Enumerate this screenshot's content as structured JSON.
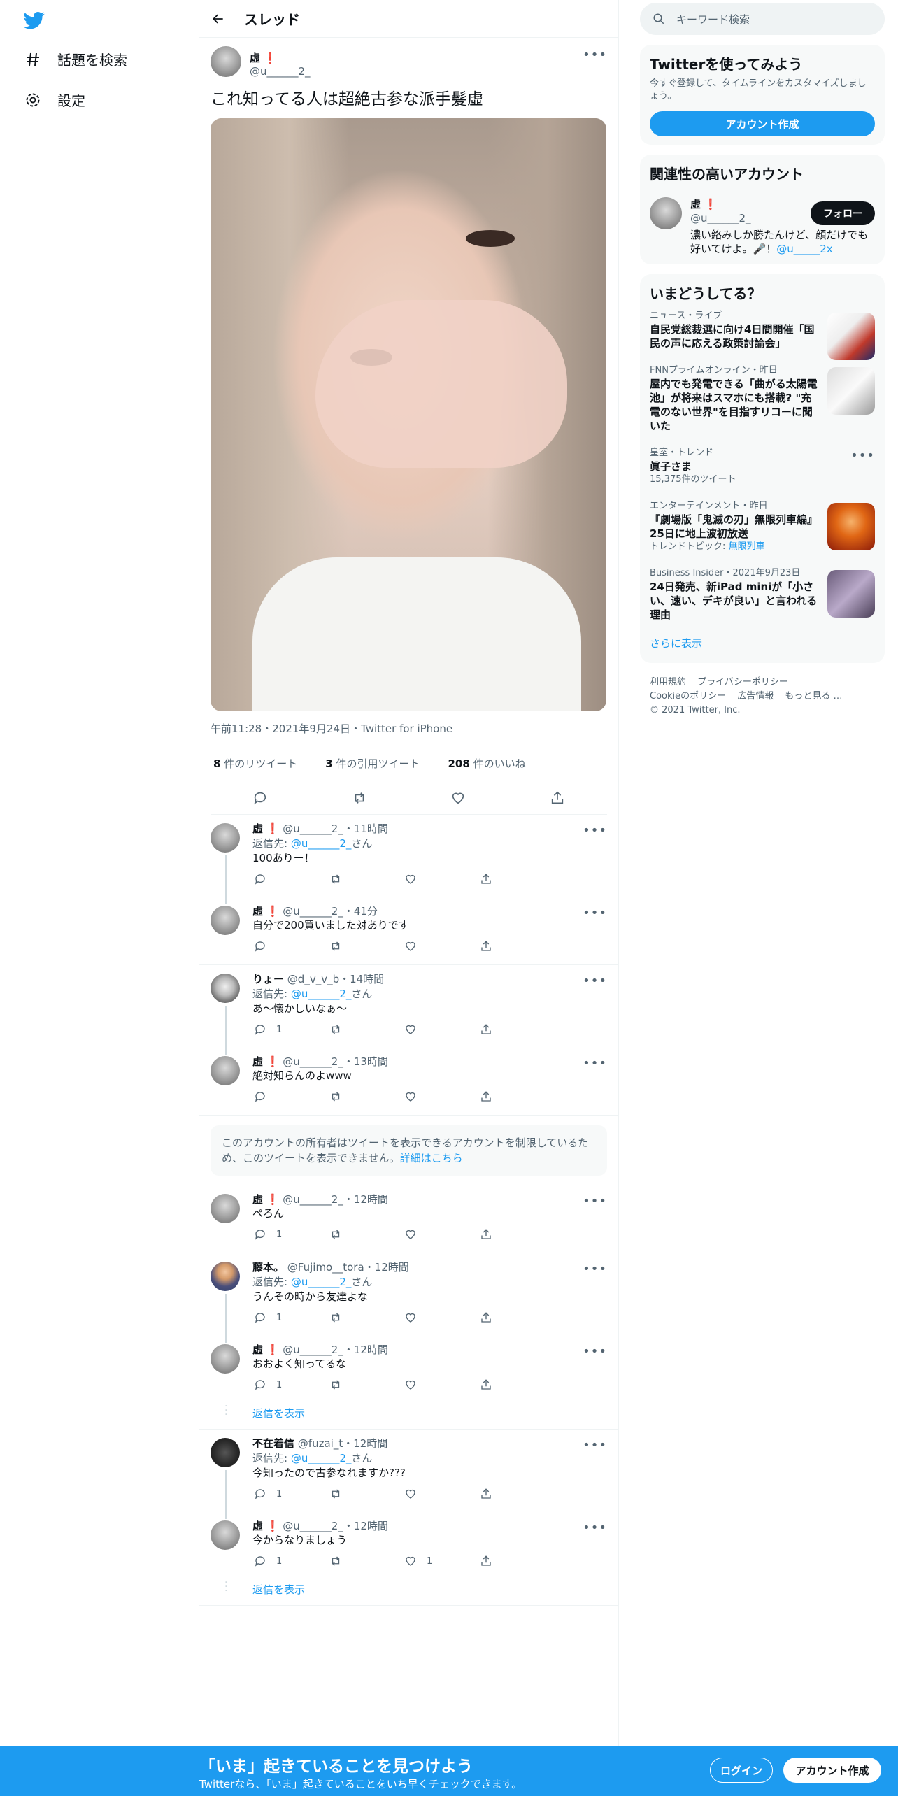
{
  "colors": {
    "accent": "#1d9bf0",
    "text": "#0f1419",
    "muted": "#536471",
    "warn": "#e0245e"
  },
  "nav": {
    "items": [
      {
        "icon": "hashtag-icon",
        "label": "話題を検索"
      },
      {
        "icon": "gear-icon",
        "label": "設定"
      }
    ]
  },
  "header": {
    "title": "スレッド"
  },
  "main_tweet": {
    "name": "虛",
    "handle": "@u______2_",
    "text": "これ知ってる人は超絶古参な派手髪虛",
    "meta": "午前11:28・2021年9月24日・Twitter for iPhone",
    "retweets": "8",
    "retweets_label": "件のリツイート",
    "quotes": "3",
    "quotes_label": "件の引用ツイート",
    "likes": "208",
    "likes_label": "件のいいね"
  },
  "replies": [
    {
      "name": "虛",
      "sub": "@u______2_・11時間",
      "reply_to_prefix": "返信先: ",
      "reply_to": "@u______2_",
      "reply_to_suffix": "さん",
      "text": "100ありー！",
      "reply_count": "",
      "like_count": ""
    },
    {
      "name": "虛",
      "sub": "@u______2_・41分",
      "text": "自分で200買いました対ありです",
      "reply_count": "",
      "like_count": ""
    },
    {
      "name": "りょー",
      "sub": "@d_v_v_b・14時間",
      "reply_to_prefix": "返信先: ",
      "reply_to": "@u______2_",
      "reply_to_suffix": "さん",
      "text": "あ～懐かしいなぁ〜",
      "reply_count": "1",
      "like_count": ""
    },
    {
      "name": "虛",
      "sub": "@u______2_・13時間",
      "text": "絶対知らんのよwww",
      "reply_count": "",
      "like_count": ""
    },
    {
      "name": "虛",
      "sub": "@u______2_・12時間",
      "text": "ぺろん",
      "reply_count": "1",
      "like_count": ""
    },
    {
      "name": "藤本。",
      "sub": "@Fujimo__tora・12時間",
      "reply_to_prefix": "返信先: ",
      "reply_to": "@u______2_",
      "reply_to_suffix": "さん",
      "text": "うんその時から友達よな",
      "reply_count": "1",
      "like_count": ""
    },
    {
      "name": "虛",
      "sub": "@u______2_・12時間",
      "text": "おおよく知ってるな",
      "reply_count": "1",
      "like_count": ""
    },
    {
      "name": "不在着信",
      "sub": "@fuzai_t・12時間",
      "reply_to_prefix": "返信先: ",
      "reply_to": "@u______2_",
      "reply_to_suffix": "さん",
      "text": "今知ったので古参なれますか???",
      "reply_count": "1",
      "like_count": ""
    },
    {
      "name": "虛",
      "sub": "@u______2_・12時間",
      "text": "今からなりましょう",
      "reply_count": "1",
      "like_count": "1"
    }
  ],
  "notice": {
    "text": "このアカウントの所有者はツイートを表示できるアカウントを制限しているため、このツイートを表示できません。",
    "link": "詳細はこちら"
  },
  "show_replies": "返信を表示",
  "sidebar": {
    "search_placeholder": "キーワード検索",
    "signup_card": {
      "title": "Twitterを使ってみよう",
      "desc": "今すぐ登録して、タイムラインをカスタマイズしましょう。",
      "button": "アカウント作成"
    },
    "related": {
      "title": "関連性の高いアカウント",
      "name": "虛",
      "handle": "@u______2_",
      "bio": "濃い絡みしか勝たんけど、顔だけでも好いてけよ。🎤！",
      "bio_link": "@u_____2x",
      "follow": "フォロー"
    },
    "trends": {
      "title": "いまどうしてる？",
      "items": [
        {
          "cat": "ニュース・ライブ",
          "title": "自民党総裁選に向け4日間開催「国民の声に応える政策討論会」",
          "sub": "",
          "sub_link": ""
        },
        {
          "cat": "FNNプライムオンライン・昨日",
          "title": "屋内でも発電できる「曲がる太陽電池」が将来はスマホにも搭載? \"充電のない世界\"を目指すリコーに聞いた",
          "sub": "",
          "sub_link": ""
        },
        {
          "cat": "皇室・トレンド",
          "title": "眞子さま",
          "sub": "15,375件のツイート",
          "sub_link": ""
        },
        {
          "cat": "エンターテインメント・昨日",
          "title": "『劇場版「鬼滅の刃」無限列車編』 25日に地上波初放送",
          "sub": "トレンドトピック: ",
          "sub_link": "無限列車"
        },
        {
          "cat": "Business Insider・2021年9月23日",
          "title": "24日発売、新iPad miniが「小さい、速い、デキが良い」と言われる理由",
          "sub": "",
          "sub_link": ""
        }
      ],
      "show_more": "さらに表示"
    },
    "footer": {
      "links": [
        "利用規約",
        "プライバシーポリシー",
        "Cookieのポリシー",
        "広告情報",
        "もっと見る …"
      ],
      "copyright": "© 2021 Twitter, Inc."
    }
  },
  "bottom": {
    "title": "「いま」起きていることを見つけよう",
    "sub": "Twitterなら、「いま」起きていることをいち早くチェックできます。",
    "login": "ログイン",
    "signup": "アカウント作成"
  }
}
